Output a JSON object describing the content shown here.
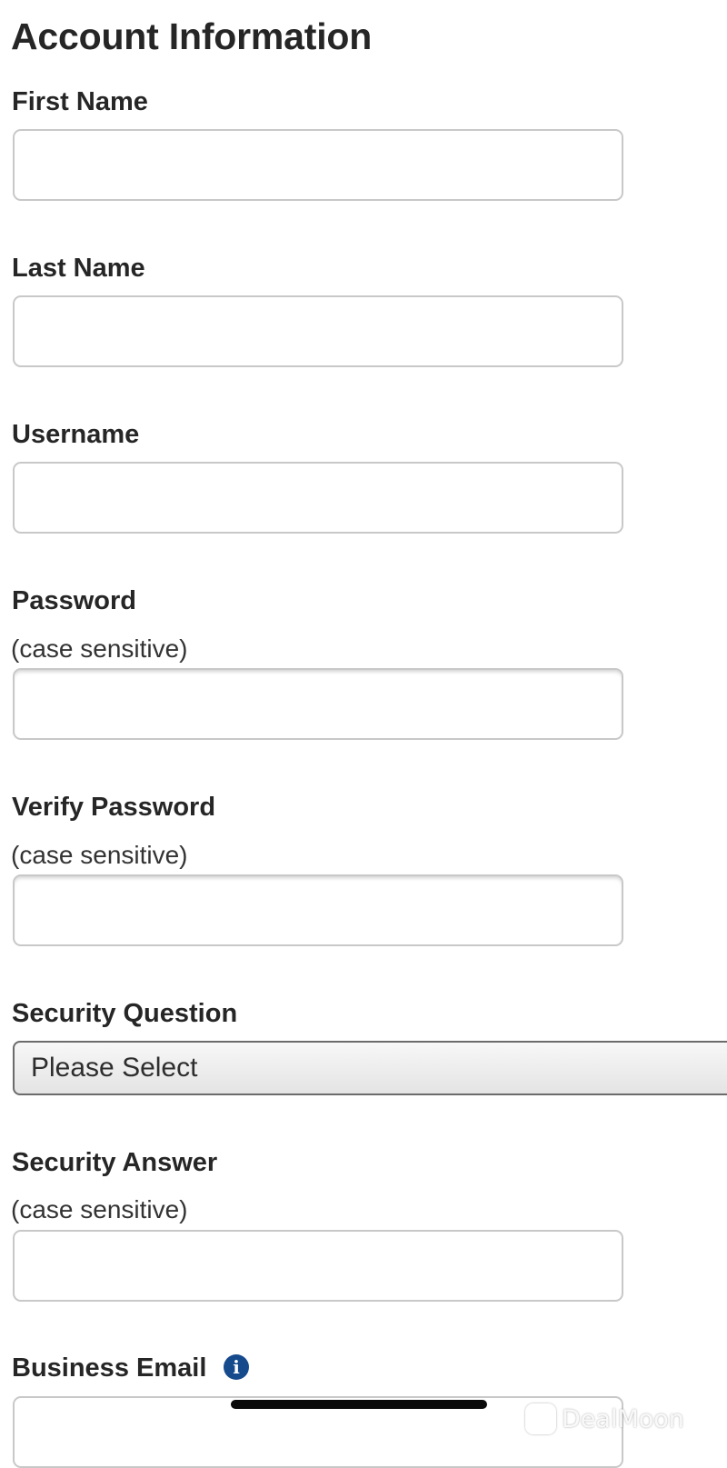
{
  "page": {
    "title": "Account Information"
  },
  "fields": {
    "first_name": {
      "label": "First Name",
      "value": "",
      "placeholder": ""
    },
    "last_name": {
      "label": "Last Name",
      "value": "",
      "placeholder": ""
    },
    "username": {
      "label": "Username",
      "value": "",
      "placeholder": ""
    },
    "password": {
      "label": "Password",
      "hint": "(case sensitive)",
      "value": "",
      "placeholder": ""
    },
    "verify_password": {
      "label": "Verify Password",
      "hint": "(case sensitive)",
      "value": "",
      "placeholder": ""
    },
    "security_question": {
      "label": "Security Question",
      "selected": "Please Select"
    },
    "security_answer": {
      "label": "Security Answer",
      "hint": "(case sensitive)",
      "value": "",
      "placeholder": ""
    },
    "business_email": {
      "label": "Business Email",
      "value": "",
      "placeholder": ""
    }
  },
  "icons": {
    "info": {
      "name": "info-icon",
      "glyph": "i",
      "color": "#154a8c"
    }
  },
  "watermark": {
    "text": "DealMoon"
  },
  "colors": {
    "text": "#262626",
    "input_border": "#c8c8c8",
    "select_border": "#6b6b6b",
    "info_icon": "#154a8c"
  }
}
